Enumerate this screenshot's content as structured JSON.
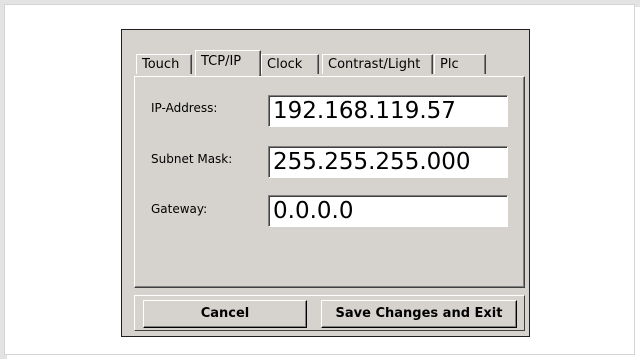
{
  "tabs": [
    {
      "label": "Touch"
    },
    {
      "label": "TCP/IP"
    },
    {
      "label": "Clock"
    },
    {
      "label": "Contrast/Light"
    },
    {
      "label": "Plc"
    }
  ],
  "active_tab": "TCP/IP",
  "fields": {
    "ip": {
      "label": "IP-Address:",
      "value": "192.168.119.57"
    },
    "subnet": {
      "label": "Subnet Mask:",
      "value": "255.255.255.000"
    },
    "gateway": {
      "label": "Gateway:",
      "value": "0.0.0.0"
    }
  },
  "buttons": {
    "cancel": "Cancel",
    "save": "Save Changes and Exit"
  },
  "colors": {
    "face": "#d6d3ce",
    "field_bg": "#ffffff"
  }
}
